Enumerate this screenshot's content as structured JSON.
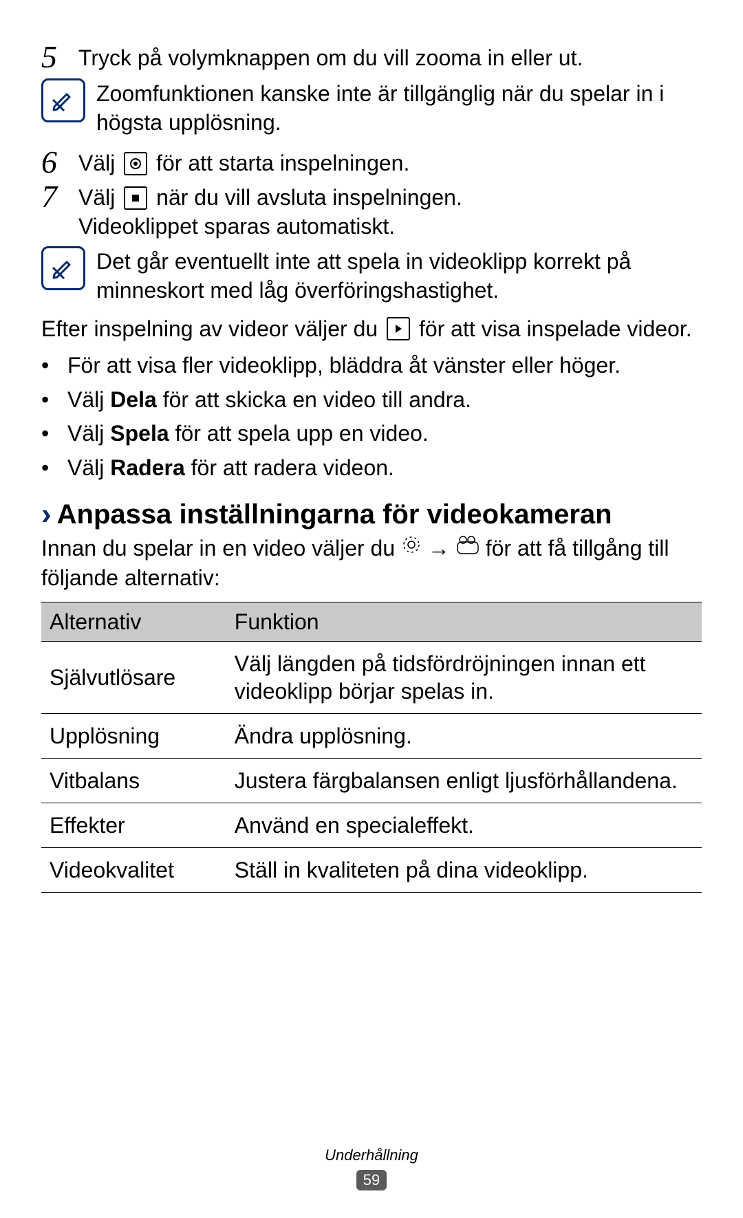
{
  "steps": {
    "s5": {
      "num": "5",
      "text": "Tryck på volymknappen om du vill zooma in eller ut."
    },
    "s6": {
      "num": "6",
      "pre": "Välj ",
      "post": " för att starta inspelningen."
    },
    "s7": {
      "num": "7",
      "pre": "Välj ",
      "mid": " när du vill avsluta inspelningen.",
      "line2": "Videoklippet sparas automatiskt."
    }
  },
  "notes": {
    "n1": "Zoomfunktionen kanske inte är tillgänglig när du spelar in i högsta upplösning.",
    "n2": "Det går eventuellt inte att spela in videoklipp korrekt på minneskort med låg överföringshastighet."
  },
  "after_recording": {
    "pre": "Efter inspelning av videor väljer du ",
    "post": " för att visa inspelade videor."
  },
  "bullets": {
    "b1": "För att visa fler videoklipp, bläddra åt vänster eller höger.",
    "b2_pre": "Välj ",
    "b2_bold": "Dela",
    "b2_post": " för att skicka en video till andra.",
    "b3_pre": "Välj ",
    "b3_bold": "Spela",
    "b3_post": " för att spela upp en video.",
    "b4_pre": "Välj ",
    "b4_bold": "Radera",
    "b4_post": " för att radera videon."
  },
  "heading": "Anpassa inställningarna för videokameran",
  "intro": {
    "pre": "Innan du spelar in en video väljer du ",
    "arrow": " → ",
    "post": " för att få tillgång till följande alternativ:"
  },
  "table": {
    "header": {
      "c1": "Alternativ",
      "c2": "Funktion"
    },
    "rows": [
      {
        "c1": "Självutlösare",
        "c2": "Välj längden på tidsfördröjningen innan ett videoklipp börjar spelas in."
      },
      {
        "c1": "Upplösning",
        "c2": "Ändra upplösning."
      },
      {
        "c1": "Vitbalans",
        "c2": "Justera färgbalansen enligt ljusförhållandena."
      },
      {
        "c1": "Effekter",
        "c2": "Använd en specialeffekt."
      },
      {
        "c1": "Videokvalitet",
        "c2": "Ställ in kvaliteten på dina videoklipp."
      }
    ]
  },
  "footer": {
    "category": "Underhållning",
    "page": "59"
  }
}
